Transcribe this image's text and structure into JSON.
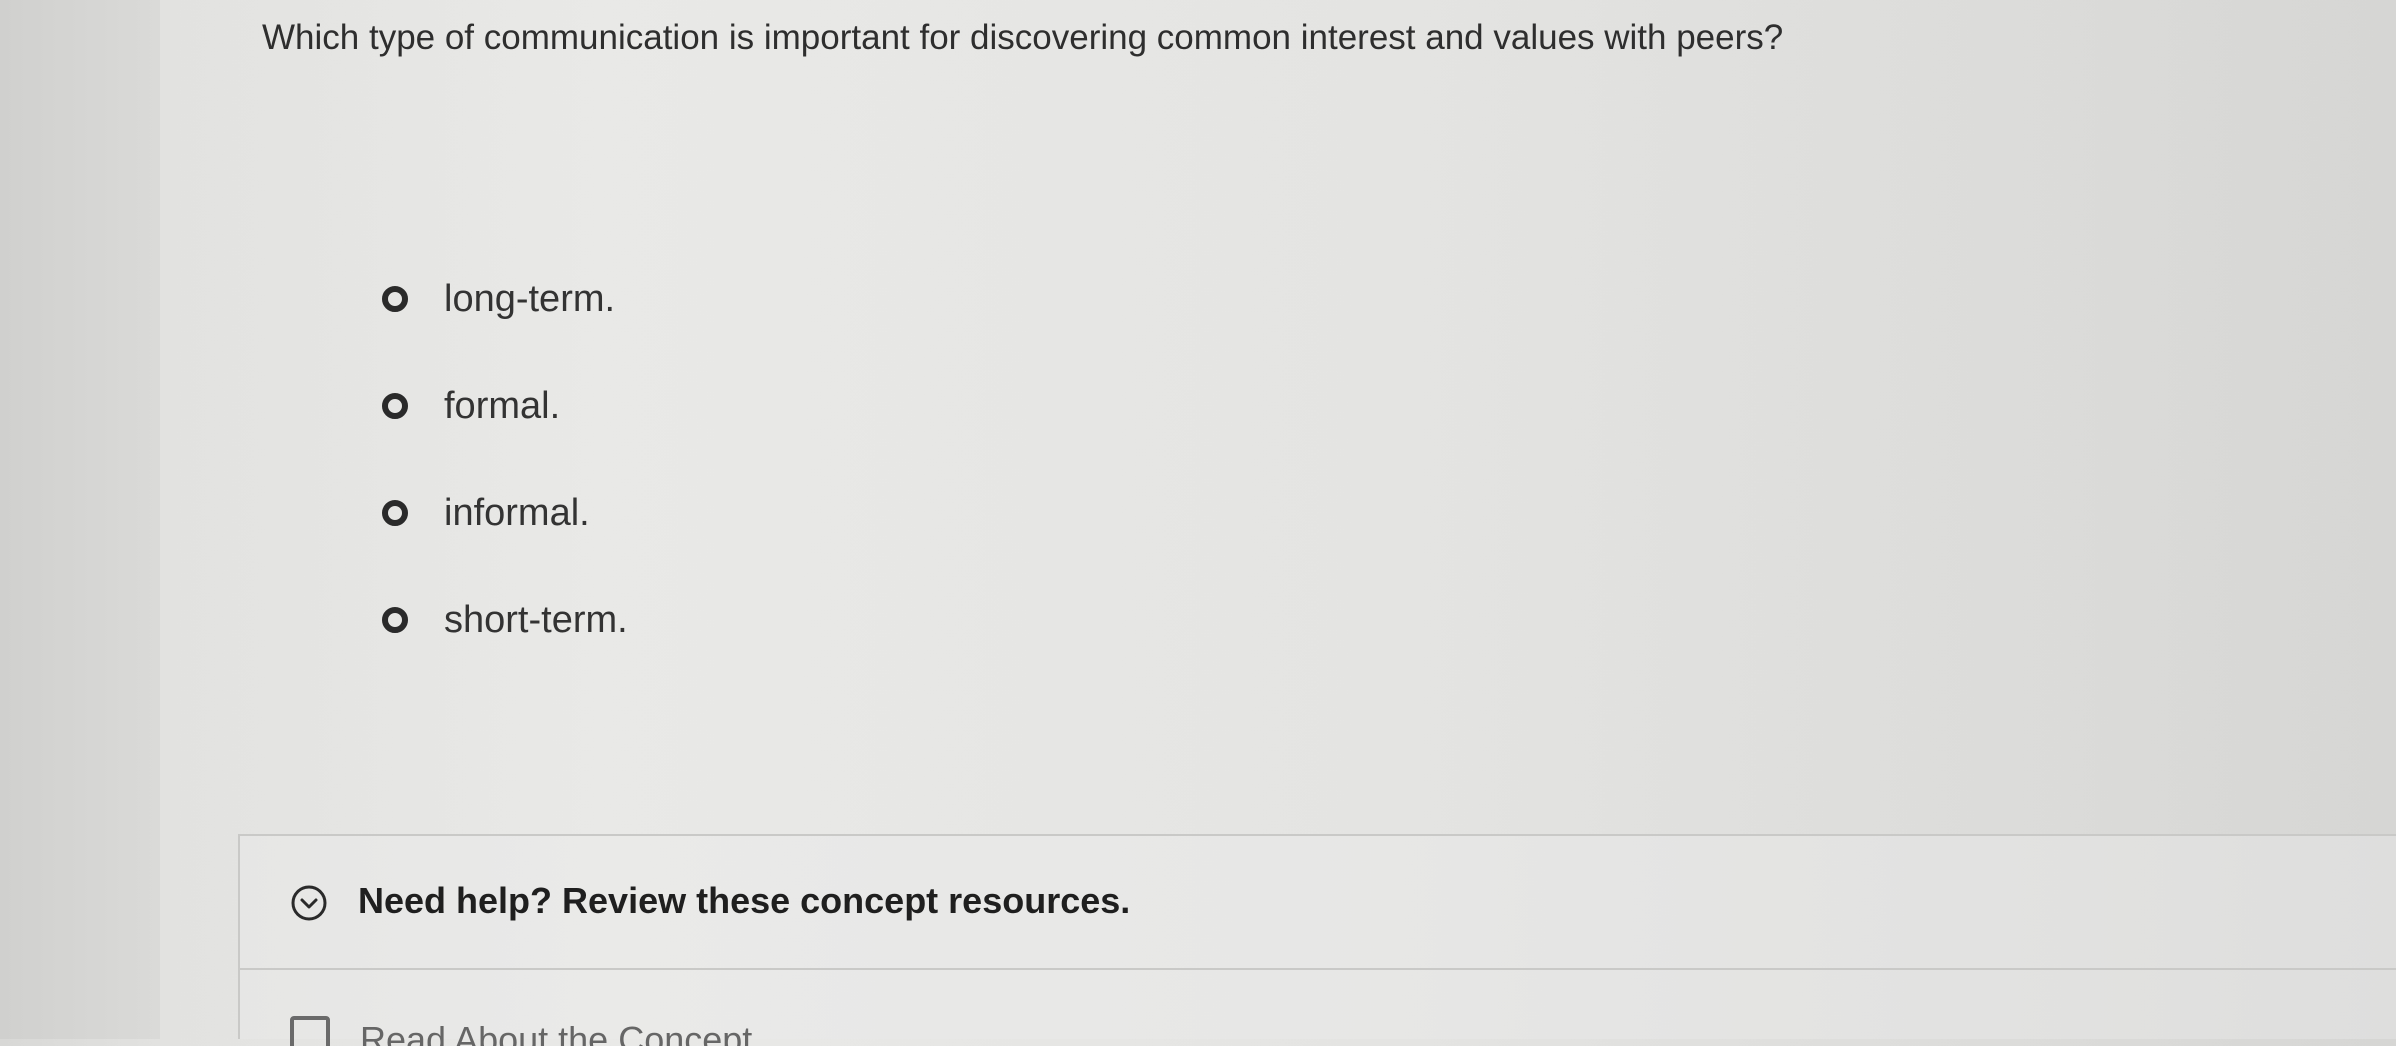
{
  "question": {
    "text": "Which type of communication is important for discovering common interest and values with peers?"
  },
  "choices": [
    {
      "label": "long-term."
    },
    {
      "label": "formal."
    },
    {
      "label": "informal."
    },
    {
      "label": "short-term."
    }
  ],
  "help": {
    "label": "Need help? Review these concept resources.",
    "icon": "chevron-down-circle-icon",
    "partial_item_label": "Read About the Concept",
    "partial_item_icon": "book-icon"
  }
}
